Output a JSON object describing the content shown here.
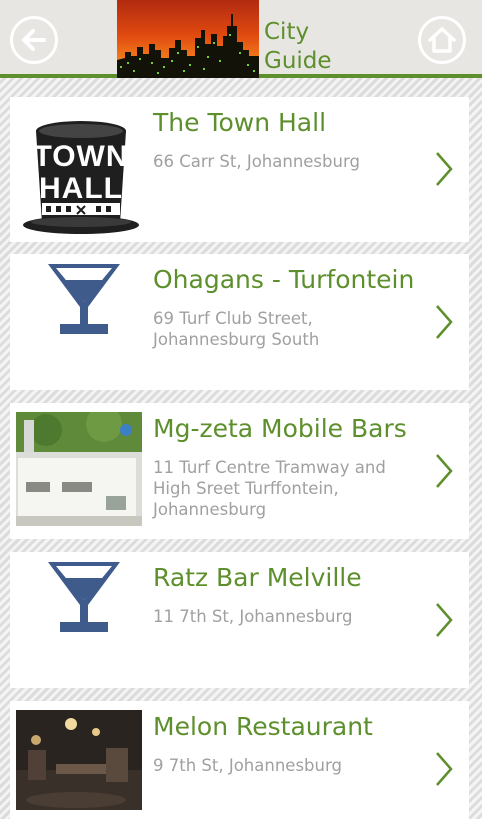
{
  "header": {
    "title": "City\nGuide",
    "back_icon": "arrow-left-icon",
    "home_icon": "home-icon",
    "accent": "#5d8f2c"
  },
  "listings": [
    {
      "name": "The Town Hall",
      "address": "66 Carr St, Johannesburg",
      "thumbnail": "town-hall-logo",
      "logo_text": [
        "TOWN",
        "HALL"
      ]
    },
    {
      "name": "Ohagans - Turfontein",
      "address": "69 Turf Club Street, Johannesburg South",
      "thumbnail": "cocktail-glass-icon"
    },
    {
      "name": "Mg-zeta Mobile Bars",
      "address": "11 Turf Centre Tramway and High Sreet Turffontein, Johannesburg",
      "thumbnail": "mobile-bar-photo"
    },
    {
      "name": "Ratz Bar Melville",
      "address": "11 7th St, Johannesburg",
      "thumbnail": "cocktail-glass-icon"
    },
    {
      "name": "Melon Restaurant",
      "address": "9 7th St, Johannesburg",
      "thumbnail": "restaurant-interior-photo"
    }
  ]
}
